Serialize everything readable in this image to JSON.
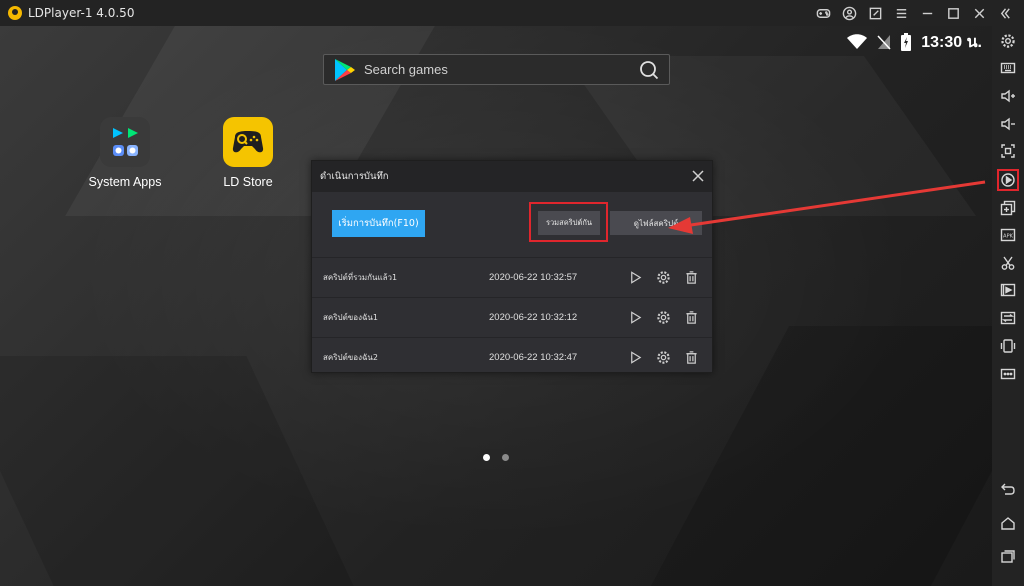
{
  "window": {
    "title": "LDPlayer-1 4.0.50",
    "controls": [
      "gamepad-icon",
      "account-icon",
      "share-icon",
      "menu-icon",
      "minimize-icon",
      "maximize-icon",
      "close-icon",
      "collapse-icon"
    ]
  },
  "status_bar": {
    "time": "13:30 น."
  },
  "search": {
    "placeholder": "Search games"
  },
  "desktop": {
    "apps": [
      {
        "label": "System Apps"
      },
      {
        "label": "LD Store"
      }
    ]
  },
  "dialog": {
    "title": "ดำเนินการบันทึก",
    "start_label": "เริ่มการบันทึก(F10)",
    "merge_label": "รวมสคริปต์กัน",
    "import_label": "ดูไฟล์สคริปต์",
    "scripts": [
      {
        "name": "สคริปต์ที่รวมกันแล้ว1",
        "date": "2020-06-22 10:32:57"
      },
      {
        "name": "สคริปต์ของฉัน1",
        "date": "2020-06-22 10:32:12"
      },
      {
        "name": "สคริปต์ของฉัน2",
        "date": "2020-06-22 10:32:47"
      }
    ]
  },
  "pager": {
    "active_page": 1,
    "total_pages": 2
  },
  "toolbar": {
    "items": [
      "settings-icon",
      "keyboard-icon",
      "volume-up-icon",
      "volume-down-icon",
      "fullscreen-icon",
      "macro-record-icon",
      "multi-instance-icon",
      "apk-icon",
      "scissors-icon",
      "video-record-icon",
      "sync-icon",
      "shake-icon",
      "more-icon"
    ],
    "nav": [
      "back-icon",
      "home-icon",
      "recents-icon"
    ],
    "apk_text": "APK"
  },
  "colors": {
    "accent_blue": "#2fa6f2",
    "annotation_red": "#e0262d",
    "ld_yellow": "#f5c400"
  }
}
